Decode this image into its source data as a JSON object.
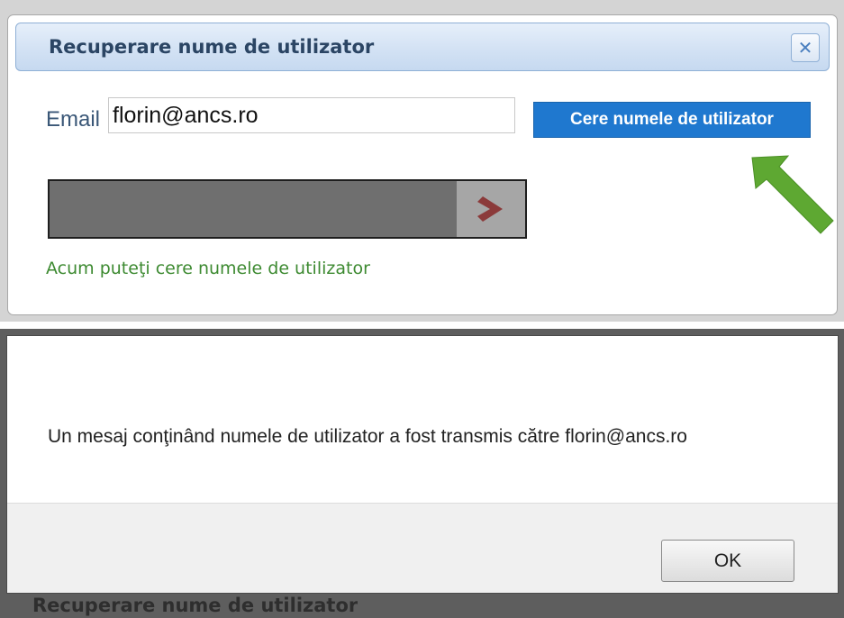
{
  "dialog": {
    "title": "Recuperare nume de utilizator",
    "close_icon": "close-icon",
    "email_label": "Email",
    "email_value": "florin@ancs.ro",
    "request_button": "Cere numele de utilizator",
    "slider_icon": "chevron-right-icon",
    "status_message": "Acum puteţi cere numele de utilizator"
  },
  "message_box": {
    "text": "Un mesaj conţinând numele de utilizator a fost transmis către florin@ancs.ro",
    "ok_button": "OK"
  },
  "background": {
    "partial_dialog_title": "Recuperare nume de utilizator"
  },
  "colors": {
    "accent_blue": "#1f78cf",
    "title_text": "#2b4564",
    "status_green": "#3d8a31",
    "arrow_green": "#5ea832",
    "slider_chevron": "#8b3a3a"
  }
}
